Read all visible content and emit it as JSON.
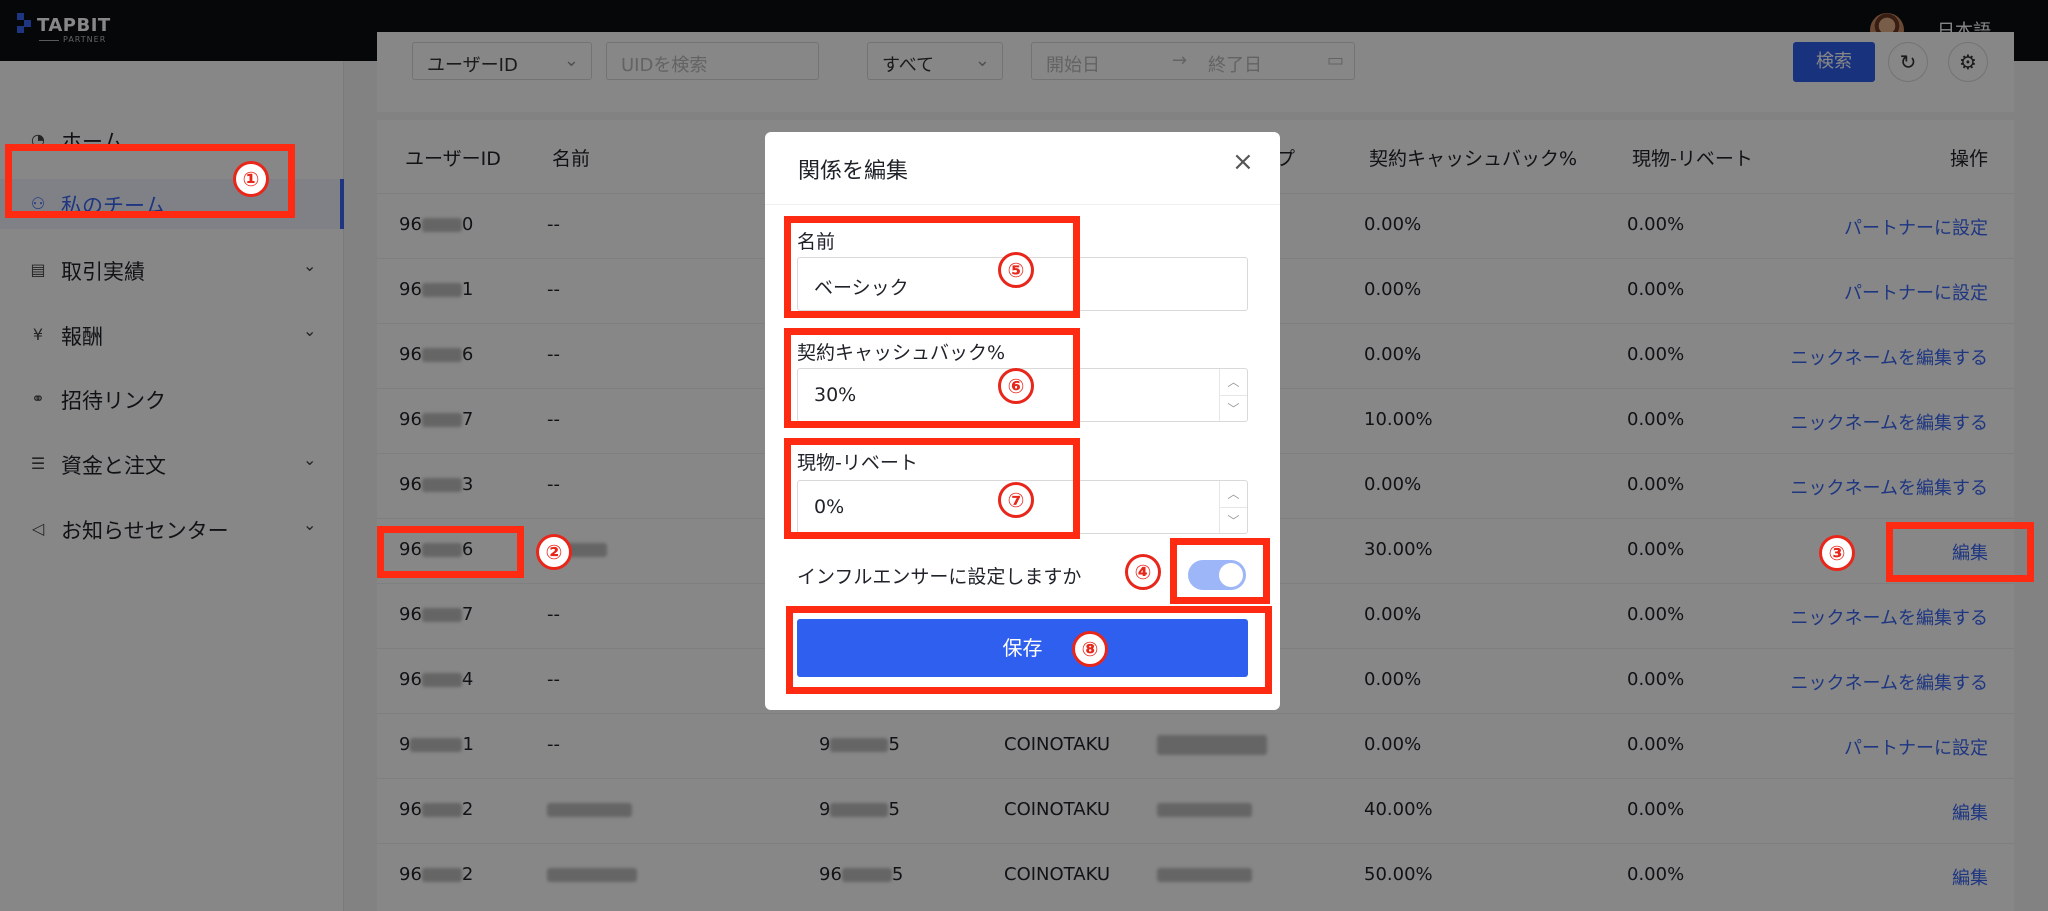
{
  "header": {
    "logo_text": "TAPBIT",
    "logo_sub": "PARTNER",
    "language": "日本語"
  },
  "sidebar": {
    "items": [
      {
        "label": "ホーム",
        "icon": "dashboard-icon",
        "has_submenu": false
      },
      {
        "label": "私のチーム",
        "icon": "team-icon",
        "has_submenu": false,
        "active": true
      },
      {
        "label": "取引実績",
        "icon": "document-icon",
        "has_submenu": true
      },
      {
        "label": "報酬",
        "icon": "yen-icon",
        "has_submenu": true
      },
      {
        "label": "招待リンク",
        "icon": "link-icon",
        "has_submenu": false
      },
      {
        "label": "資金と注文",
        "icon": "list-icon",
        "has_submenu": true
      },
      {
        "label": "お知らせセンター",
        "icon": "megaphone-icon",
        "has_submenu": true
      }
    ]
  },
  "filters": {
    "id_type": "ユーザーID",
    "uid_placeholder": "UIDを検索",
    "status": "すべて",
    "start_placeholder": "開始日",
    "end_placeholder": "終了日",
    "search_label": "検索"
  },
  "table": {
    "columns": [
      "ユーザーID",
      "名前",
      "イプ",
      "契約キャッシュバック%",
      "現物-リベート",
      "操作"
    ],
    "rows": [
      {
        "id_pre": "96",
        "id_suf": "0",
        "name": "--",
        "contract": "0.00%",
        "spot": "0.00%",
        "action": "パートナーに設定"
      },
      {
        "id_pre": "96",
        "id_suf": "1",
        "name": "--",
        "contract": "0.00%",
        "spot": "0.00%",
        "action": "パートナーに設定"
      },
      {
        "id_pre": "96",
        "id_suf": "6",
        "name": "--",
        "contract": "0.00%",
        "spot": "0.00%",
        "action": "ニックネームを編集する"
      },
      {
        "id_pre": "96",
        "id_suf": "7",
        "name": "--",
        "contract": "10.00%",
        "spot": "0.00%",
        "action": "ニックネームを編集する"
      },
      {
        "id_pre": "96",
        "id_suf": "3",
        "name": "--",
        "contract": "0.00%",
        "spot": "0.00%",
        "action": "ニックネームを編集する"
      },
      {
        "id_pre": "96",
        "id_suf": "6",
        "name": "",
        "contract": "30.00%",
        "spot": "0.00%",
        "action": "編集"
      },
      {
        "id_pre": "96",
        "id_suf": "7",
        "name": "--",
        "contract": "0.00%",
        "spot": "0.00%",
        "action": "ニックネームを編集する"
      },
      {
        "id_pre": "96",
        "id_suf": "4",
        "name": "--",
        "contract": "0.00%",
        "spot": "0.00%",
        "action": "ニックネームを編集する"
      },
      {
        "id_pre": "9",
        "id_suf": "1",
        "name": "--",
        "inv_pre": "9",
        "inv_suf": "5",
        "type": "COINOTAKU",
        "contract": "0.00%",
        "spot": "0.00%",
        "action": "パートナーに設定"
      },
      {
        "id_pre": "96",
        "id_suf": "2",
        "name": "",
        "inv_pre": "9",
        "inv_suf": "5",
        "type": "COINOTAKU",
        "contract": "40.00%",
        "spot": "0.00%",
        "action": "編集"
      },
      {
        "id_pre": "96",
        "id_suf": "2",
        "name": "",
        "inv_pre": "96",
        "inv_suf": "5",
        "type": "COINOTAKU",
        "contract": "50.00%",
        "spot": "0.00%",
        "action": "編集"
      }
    ]
  },
  "modal": {
    "title": "関係を編集",
    "name_label": "名前",
    "name_value": "ベーシック",
    "contract_label": "契約キャッシュバック%",
    "contract_value": "30%",
    "spot_label": "現物-リベート",
    "spot_value": "0%",
    "influencer_label": "インフルエンサーに設定しますか",
    "influencer_on": true,
    "save_label": "保存"
  },
  "annotations": {
    "colors": {
      "highlight": "#ff2a12",
      "accent": "#2f5fef"
    },
    "badges": [
      "①",
      "②",
      "③",
      "④",
      "⑤",
      "⑥",
      "⑦",
      "⑧"
    ]
  }
}
